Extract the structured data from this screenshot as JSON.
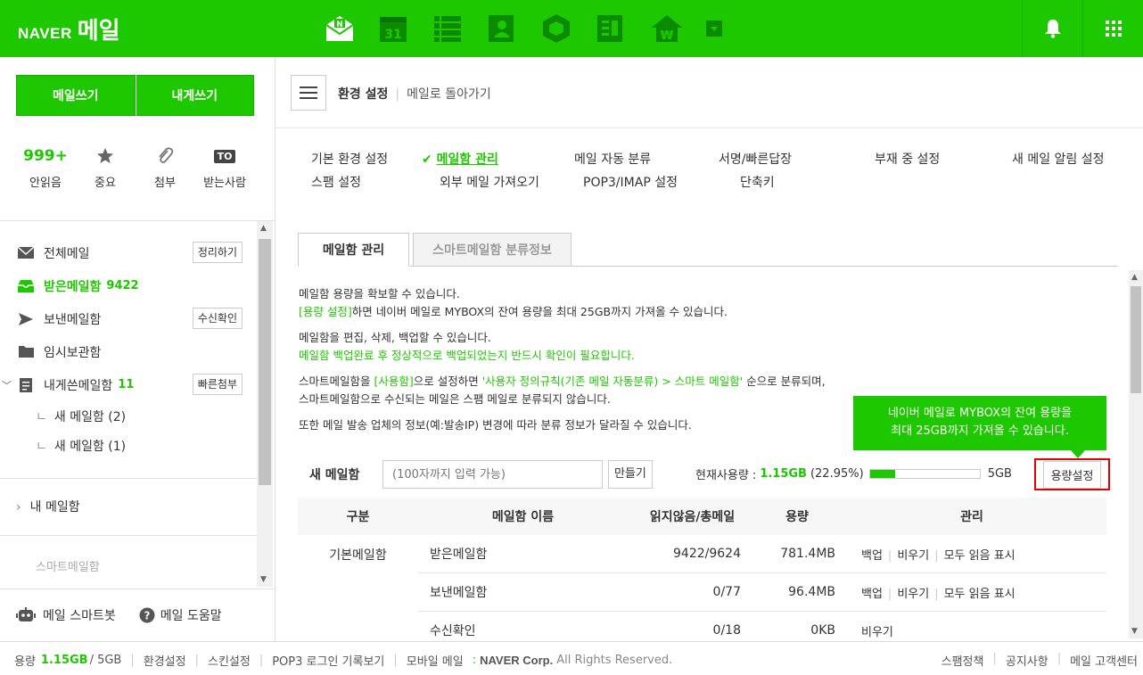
{
  "header": {
    "brand": "NAVER",
    "title": "메일",
    "apps": [
      "mail-app-icon",
      "calendar-icon",
      "list-icon",
      "contacts-icon",
      "box-icon",
      "note-icon",
      "pay-icon",
      "more-dropdown-icon"
    ],
    "calendar_day": "31"
  },
  "sidebar": {
    "compose_label": "메일쓰기",
    "self_compose_label": "내게쓰기",
    "quick": [
      {
        "value": "999+",
        "label": "안읽음"
      },
      {
        "label": "중요"
      },
      {
        "label": "첨부"
      },
      {
        "badge": "TO",
        "label": "받는사람"
      }
    ],
    "folders": [
      {
        "label": "전체메일",
        "button": "정리하기"
      },
      {
        "label": "받은메일함",
        "count": "9422"
      },
      {
        "label": "보낸메일함",
        "button": "수신확인"
      },
      {
        "label": "임시보관함"
      },
      {
        "label": "내게쓴메일함",
        "count": "11",
        "button": "빠른첨부"
      }
    ],
    "sub_folders": [
      {
        "label": "새 메일함 (2)"
      },
      {
        "label": "새 메일함 (1)"
      }
    ],
    "elbow": "ㄴ",
    "my_mailbox": "내 메일함",
    "smart_mailbox": "스마트메일함",
    "bottom": {
      "bot": "메일 스마트봇",
      "help": "메일 도움말"
    }
  },
  "topbar": {
    "current": "환경 설정",
    "separator": "|",
    "back": "메일로 돌아가기"
  },
  "settings_menu": [
    "기본 환경 설정",
    "메일함 관리",
    "메일 자동 분류",
    "서명/빠른답장",
    "부재 중 설정",
    "새 메일 알림 설정",
    "스팸 설정",
    "외부 메일 가져오기",
    "POP3/IMAP 설정",
    "단축키"
  ],
  "tabs": {
    "active": "메일함 관리",
    "inactive": "스마트메일함 분류정보"
  },
  "description": {
    "p1_line1": "메일함 용량을 확보할 수 있습니다.",
    "p1_link": "[용량 설정]",
    "p1_line2": "하면 네이버 메일로 MYBOX의 잔여 용량을 최대 25GB까지 가져올 수 있습니다.",
    "p2_line1": "메일함을 편집, 삭제, 백업할 수 있습니다.",
    "p2_line2": "메일함 백업완료 후 정상적으로 백업되었는지 반드시 확인이 필요합니다.",
    "p3_a": "스마트메일함을 ",
    "p3_b": "[사용함]",
    "p3_c": "으로 설정하면 ",
    "p3_d": "'사용자 정의규칙(기존 메일 자동분류) > 스마트 메일함'",
    "p3_e": " 순으로 분류되며,",
    "p3_line2": "스마트메일함으로 수신되는 메일은 스팸 메일로 분류되지 않습니다.",
    "p4": "또한 메일 발송 업체의 정보(예:발송IP) 변경에 따라 분류 정보가 달라질 수 있습니다."
  },
  "tooltip": {
    "line1": "네이버 메일로 MYBOX의 잔여 용량을",
    "line2": "최대 25GB까지 가져올 수 있습니다."
  },
  "new_mailbox": {
    "label": "새 메일함",
    "placeholder": "(100자까지 입력 가능)",
    "create": "만들기"
  },
  "usage": {
    "label": "현재사용량 :",
    "used": "1.15GB",
    "percent_text": "(22.95%)",
    "percent": 22.95,
    "max": "5GB",
    "button": "용량설정"
  },
  "table": {
    "headers": [
      "구분",
      "메일함 이름",
      "읽지않음/총메일",
      "용량",
      "관리"
    ],
    "group": "기본메일함",
    "rows": [
      {
        "name": "받은메일함",
        "counts": "9422/9624",
        "size": "781.4MB",
        "actions": [
          "백업",
          "비우기",
          "모두 읽음 표시"
        ]
      },
      {
        "name": "보낸메일함",
        "counts": "0/77",
        "size": "96.4MB",
        "actions": [
          "백업",
          "비우기",
          "모두 읽음 표시"
        ]
      },
      {
        "name": "수신확인",
        "counts": "0/18",
        "size": "0KB",
        "actions": [
          "비우기"
        ]
      }
    ],
    "sep": "|"
  },
  "footer": {
    "usage_label": "용량",
    "used": "1.15GB",
    "total": "/ 5GB",
    "links": [
      "환경설정",
      "스킨설정",
      "POP3 로그인 기록보기",
      "모바일 메일"
    ],
    "corp": "NAVER Corp.",
    "rights": "All Rights Reserved.",
    "right_links": [
      "스팸정책",
      "공지사항",
      "메일 고객센터"
    ],
    "sep": "|"
  },
  "colors": {
    "brand": "#1ec800",
    "highlight": "#e50000"
  }
}
